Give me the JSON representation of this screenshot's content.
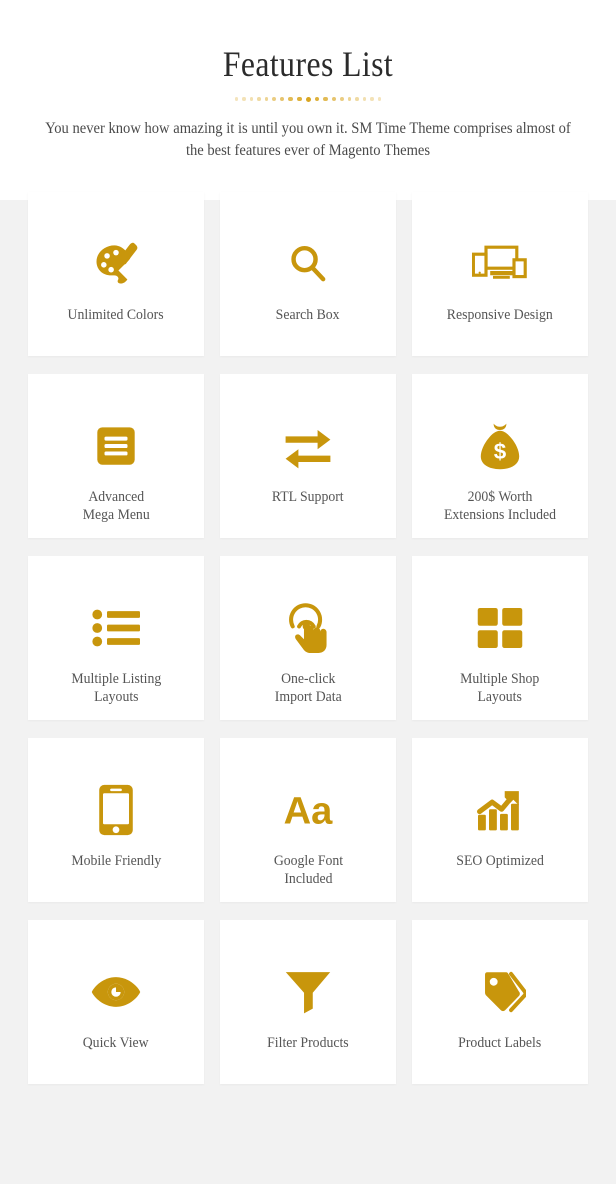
{
  "header": {
    "title": "Features List",
    "subtitle": "You never know how amazing it is until you own it. SM Time Theme comprises almost of the best features ever of Magento Themes",
    "divider_dot_count": 19
  },
  "theme": {
    "accent_color": "#c8960c",
    "page_background": "#f2f2f2",
    "card_background": "#ffffff",
    "title_color": "#2b2b2b",
    "label_color": "#555555",
    "divider_dot_color": "#d9a520"
  },
  "features": [
    {
      "label": "Unlimited Colors",
      "icon": "palette-icon"
    },
    {
      "label": "Search Box",
      "icon": "search-icon"
    },
    {
      "label": "Responsive Design",
      "icon": "responsive-devices-icon"
    },
    {
      "label": "Advanced\nMega Menu",
      "icon": "hamburger-menu-icon"
    },
    {
      "label": "RTL Support",
      "icon": "two-way-arrows-icon"
    },
    {
      "label": "200$ Worth\nExtensions Included",
      "icon": "money-bag-icon"
    },
    {
      "label": "Multiple Listing\nLayouts",
      "icon": "bulleted-list-icon"
    },
    {
      "label": "One-click\nImport Data",
      "icon": "tap-hand-icon"
    },
    {
      "label": "Multiple Shop\nLayouts",
      "icon": "grid-squares-icon"
    },
    {
      "label": "Mobile Friendly",
      "icon": "mobile-phone-icon"
    },
    {
      "label": "Google Font\nIncluded",
      "icon": "font-aa-icon"
    },
    {
      "label": "SEO Optimized",
      "icon": "growth-chart-icon"
    },
    {
      "label": "Quick View",
      "icon": "eye-icon"
    },
    {
      "label": "Filter Products",
      "icon": "funnel-filter-icon"
    },
    {
      "label": "Product Labels",
      "icon": "price-tags-icon"
    }
  ]
}
